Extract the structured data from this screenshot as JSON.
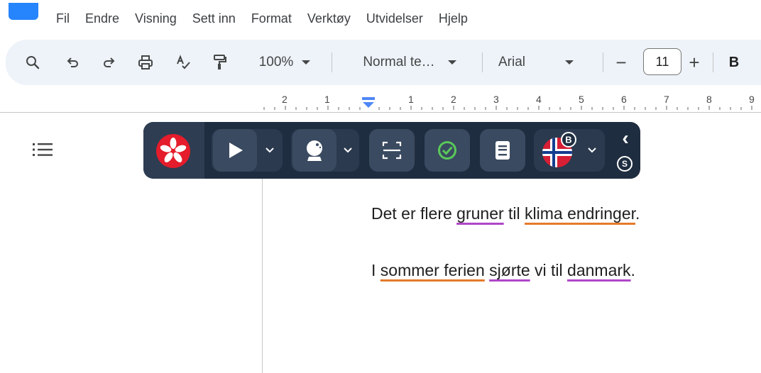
{
  "menubar": {
    "items": [
      "Fil",
      "Endre",
      "Visning",
      "Sett inn",
      "Format",
      "Verktøy",
      "Utvidelser",
      "Hjelp"
    ]
  },
  "toolbar": {
    "zoom": "100%",
    "style": "Normal te…",
    "font": "Arial",
    "font_size": "11",
    "minus": "−",
    "plus": "+",
    "bold": "B"
  },
  "ruler": {
    "left_labels": [
      "2",
      "1"
    ],
    "right_labels": [
      "1",
      "2",
      "3",
      "4",
      "5",
      "6",
      "7",
      "8",
      "9"
    ]
  },
  "extension": {
    "badge_b": "B",
    "badge_s": "S",
    "collapse": "‹"
  },
  "document": {
    "line1": [
      {
        "text": "Det er flere ",
        "style": "plain"
      },
      {
        "text": "gruner",
        "style": "purple"
      },
      {
        "text": " til ",
        "style": "plain"
      },
      {
        "text": "klima endringer",
        "style": "orange"
      },
      {
        "text": ".",
        "style": "plain"
      }
    ],
    "line2": [
      {
        "text": "I ",
        "style": "plain"
      },
      {
        "text": "sommer ferien",
        "style": "orange"
      },
      {
        "text": " ",
        "style": "plain"
      },
      {
        "text": "sjørte",
        "style": "purple"
      },
      {
        "text": " vi til ",
        "style": "plain"
      },
      {
        "text": "danmark",
        "style": "purple"
      },
      {
        "text": ".",
        "style": "plain"
      }
    ]
  },
  "colors": {
    "accent": "#2684fc",
    "extension_bg": "#1f2d40",
    "logo_red": "#e41c2b",
    "check_green": "#5ac85a",
    "underline_purple": "#b046c8",
    "underline_orange": "#e37b2c"
  }
}
